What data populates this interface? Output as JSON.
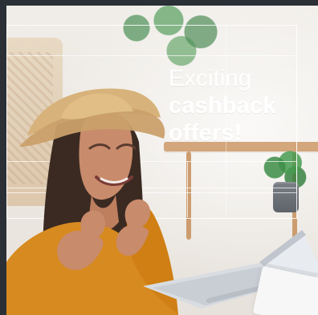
{
  "promo": {
    "line_1": "Exciting",
    "line_2": "cashback",
    "line_3": "offers!"
  },
  "colors": {
    "frame_bg": "#2b2f36",
    "text": "#ffffff",
    "accent_orange": "#d78a1f"
  }
}
